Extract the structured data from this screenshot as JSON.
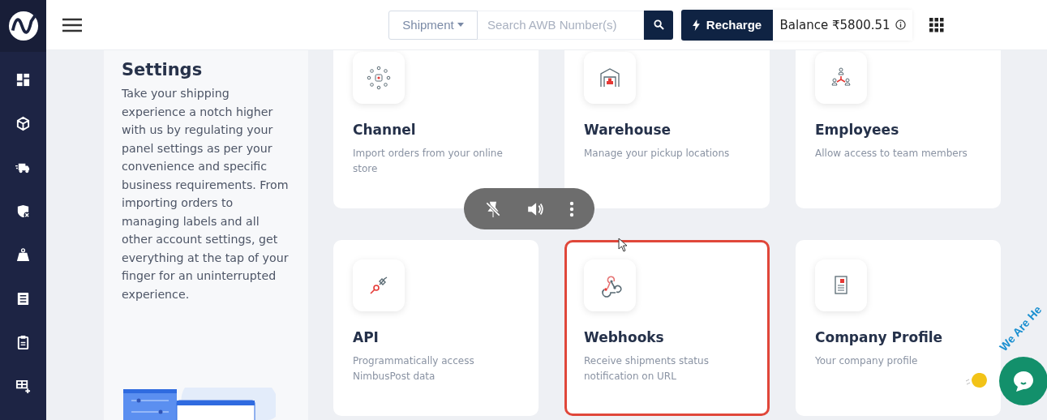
{
  "topbar": {
    "search_scope": "Shipment",
    "search": {
      "placeholder": "Search AWB Number(s)"
    },
    "recharge": "Recharge",
    "balance": "Balance ₹5800.51"
  },
  "settings_panel": {
    "title": "Settings",
    "description": "Take your shipping experience a notch higher with us by regulating your panel settings as per your convenience and specific business requirements. From importing orders to managing labels and all other account settings, get everything at the tap of your finger for an uninterrupted experience."
  },
  "cards": [
    {
      "title": "Channel",
      "description": "Import orders from your online store",
      "highlighted": false
    },
    {
      "title": "Warehouse",
      "description": "Manage your pickup locations",
      "highlighted": false
    },
    {
      "title": "Employees",
      "description": "Allow access to team members",
      "highlighted": false
    },
    {
      "title": "API",
      "description": "Programmatically access NimbusPost data",
      "highlighted": false
    },
    {
      "title": "Webhooks",
      "description": "Receive shipments status notification on URL",
      "highlighted": true
    },
    {
      "title": "Company Profile",
      "description": "Your company profile",
      "highlighted": false
    }
  ],
  "chat": {
    "label": "We Are He"
  }
}
